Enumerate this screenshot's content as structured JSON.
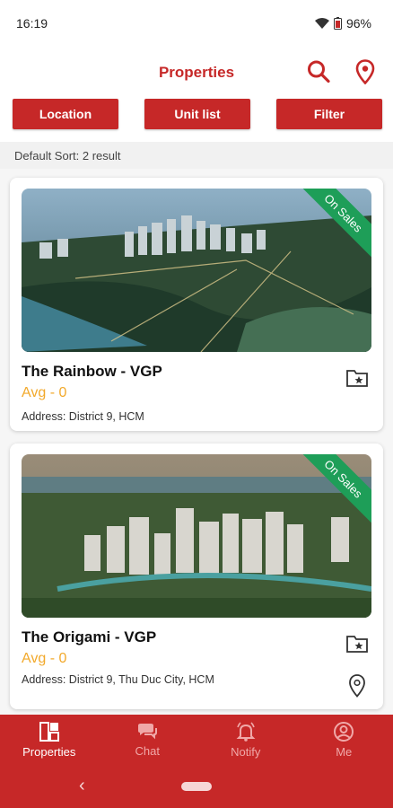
{
  "status_bar": {
    "time": "16:19",
    "battery": "96%"
  },
  "header": {
    "title": "Properties",
    "search_icon": "search-icon",
    "location_icon": "map-pin-icon"
  },
  "filters": {
    "location": "Location",
    "unit_list": "Unit list",
    "filter": "Filter"
  },
  "sort": {
    "text": "Default Sort: 2 result"
  },
  "listings": [
    {
      "name": "The Rainbow - VGP",
      "avg": "Avg - 0",
      "address": "Address: District 9, HCM",
      "badge": "On Sales"
    },
    {
      "name": "The Origami - VGP",
      "avg": "Avg - 0",
      "address": "Address: District 9, Thu Duc City, HCM",
      "badge": "On Sales"
    }
  ],
  "bottom_nav": [
    {
      "label": "Properties",
      "icon": "properties-icon",
      "active": true
    },
    {
      "label": "Chat",
      "icon": "chat-icon",
      "active": false
    },
    {
      "label": "Notify",
      "icon": "bell-icon",
      "active": false
    },
    {
      "label": "Me",
      "icon": "user-icon",
      "active": false
    }
  ],
  "system_nav": {
    "back": "‹"
  },
  "colors": {
    "brand": "#c62828",
    "badge": "#1e9e58",
    "avg": "#f2a92b"
  }
}
